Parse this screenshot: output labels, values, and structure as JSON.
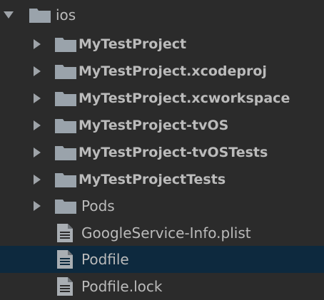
{
  "tree": {
    "root": {
      "label": "ios",
      "expanded": true,
      "icon": "folder-icon"
    },
    "items": [
      {
        "label": "MyTestProject",
        "type": "folder",
        "expanded": false,
        "bold": true
      },
      {
        "label": "MyTestProject.xcodeproj",
        "type": "folder",
        "expanded": false,
        "bold": true
      },
      {
        "label": "MyTestProject.xcworkspace",
        "type": "folder",
        "expanded": false,
        "bold": true
      },
      {
        "label": "MyTestProject-tvOS",
        "type": "folder",
        "expanded": false,
        "bold": true
      },
      {
        "label": "MyTestProject-tvOSTests",
        "type": "folder",
        "expanded": false,
        "bold": true
      },
      {
        "label": "MyTestProjectTests",
        "type": "folder",
        "expanded": false,
        "bold": true
      },
      {
        "label": "Pods",
        "type": "folder",
        "expanded": false,
        "bold": false
      },
      {
        "label": "GoogleService-Info.plist",
        "type": "file",
        "bold": false
      },
      {
        "label": "Podfile",
        "type": "file",
        "bold": false,
        "selected": true
      },
      {
        "label": "Podfile.lock",
        "type": "file",
        "bold": false
      }
    ]
  },
  "colors": {
    "background": "#2b2b2b",
    "text": "#bbbbbb",
    "folder": "#9aa3ab",
    "arrow": "#9ea3a8",
    "selection": "#0d293e"
  }
}
